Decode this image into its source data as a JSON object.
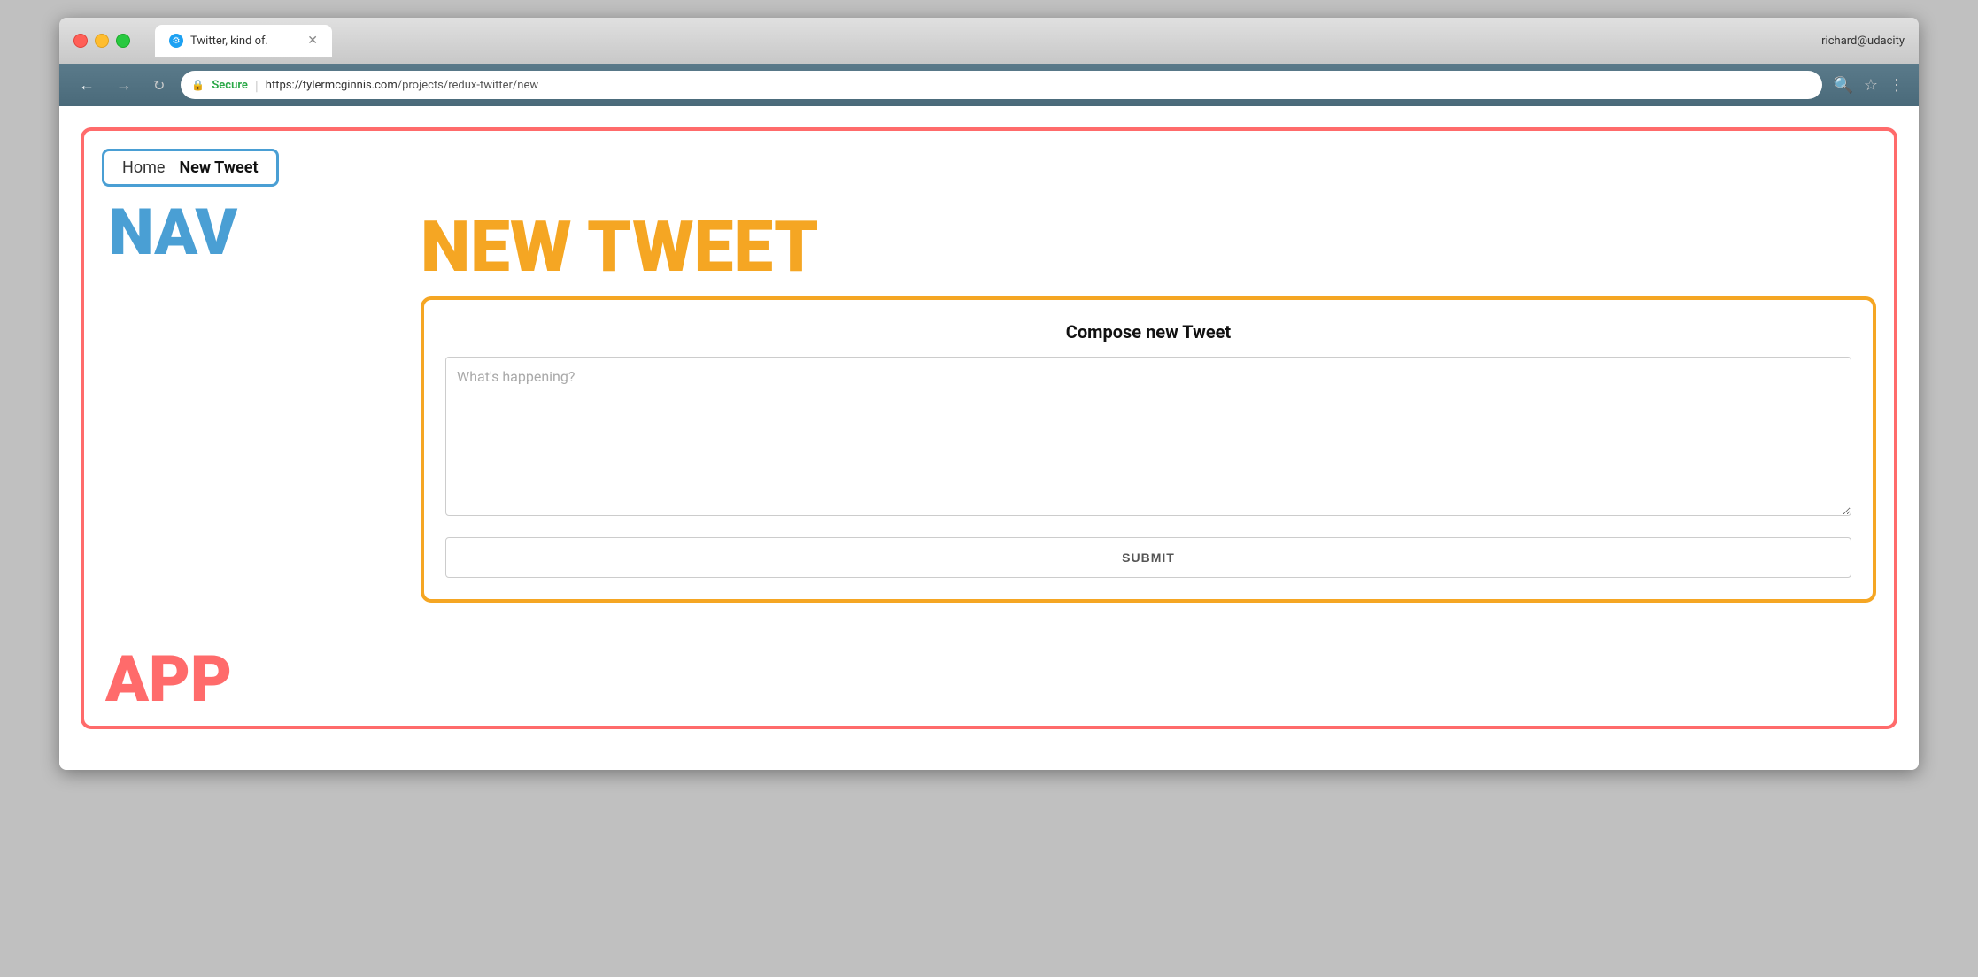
{
  "browser": {
    "traffic_lights": [
      "red",
      "yellow",
      "green"
    ],
    "tab": {
      "favicon_symbol": "⚙",
      "title": "Twitter, kind of.",
      "close": "✕"
    },
    "user": "richard@udacity",
    "nav": {
      "back": "←",
      "forward": "→",
      "refresh": "↻"
    },
    "address": {
      "secure_label": "Secure",
      "url_base": "https://tylermcginnis.com",
      "url_path": "/projects/redux-twitter/new"
    },
    "toolbar_icons": {
      "search": "🔍",
      "bookmark": "☆",
      "menu": "⋮"
    }
  },
  "app": {
    "label": "APP",
    "nav": {
      "label": "NAV",
      "breadcrumb": {
        "home": "Home",
        "current": "New Tweet"
      }
    },
    "new_tweet": {
      "heading": "NEW TWEET",
      "compose": {
        "title": "Compose new Tweet",
        "textarea_placeholder": "What's happening?",
        "submit_label": "SUBMIT"
      }
    }
  }
}
